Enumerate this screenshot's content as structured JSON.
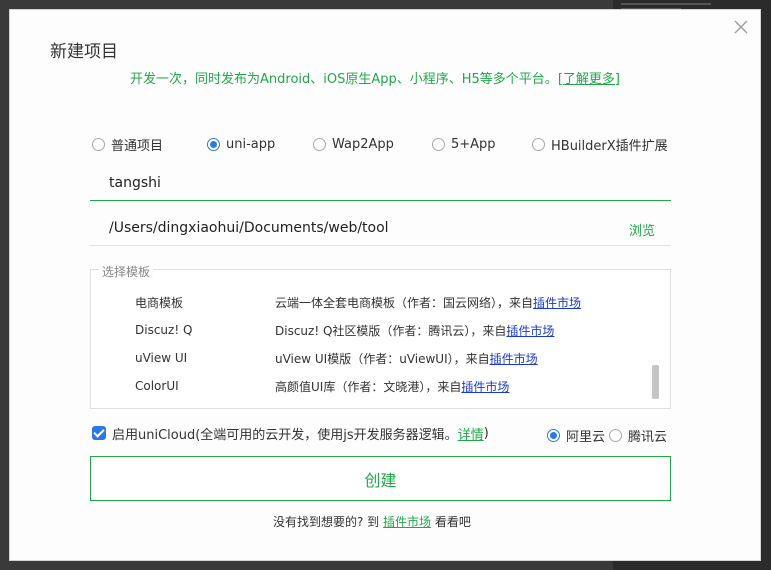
{
  "dialog": {
    "title": "新建项目",
    "subtitle": "开发一次，同时发布为Android、iOS原生App、小程序、H5等多个平台。",
    "subtitle_link": "[了解更多]"
  },
  "project_types": [
    {
      "label": "普通项目",
      "selected": false
    },
    {
      "label": "uni-app",
      "selected": true
    },
    {
      "label": "Wap2App",
      "selected": false
    },
    {
      "label": "5+App",
      "selected": false
    },
    {
      "label": "HBuilderX插件扩展",
      "selected": false
    }
  ],
  "project_name": "tangshi",
  "location": {
    "path": "/Users/dingxiaohui/Documents/web/tool",
    "browse_label": "浏览"
  },
  "templates": {
    "legend": "选择模板",
    "items": [
      {
        "name": "电商模板",
        "desc": "云端一体全套电商模板（作者：国云网络），来自",
        "link": "插件市场"
      },
      {
        "name": "Discuz! Q",
        "desc": "Discuz! Q社区模版（作者：腾讯云），来自",
        "link": "插件市场"
      },
      {
        "name": "uView UI",
        "desc": "uView UI模版（作者：uViewUI），来自",
        "link": "插件市场"
      },
      {
        "name": "ColorUI",
        "desc": "高颜值UI库（作者：文晓港），来自",
        "link": "插件市场"
      }
    ]
  },
  "unicloud": {
    "checked": true,
    "label": "启用uniCloud(全端可用的云开发，使用js开发服务器逻辑。",
    "link": "详情",
    "label_end": ")",
    "providers": [
      {
        "label": "阿里云",
        "selected": true
      },
      {
        "label": "腾讯云",
        "selected": false
      }
    ]
  },
  "create_button": "创建",
  "footer": {
    "prefix": "没有找到想要的? 到",
    "link": "插件市场",
    "suffix": "看看吧"
  },
  "colors": {
    "accent": "#22a84a",
    "radio": "#2a7ae2",
    "link": "#1a3bd1"
  },
  "icons": {
    "close": "close-icon"
  }
}
